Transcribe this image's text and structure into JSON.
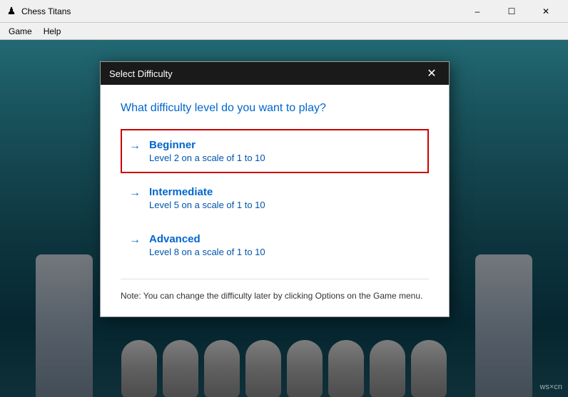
{
  "titlebar": {
    "icon": "♟",
    "title": "Chess Titans",
    "minimize_label": "–",
    "maximize_label": "☐",
    "close_label": "✕"
  },
  "menubar": {
    "items": [
      {
        "id": "game",
        "label": "Game"
      },
      {
        "id": "help",
        "label": "Help"
      }
    ]
  },
  "dialog": {
    "title": "Select Difficulty",
    "close_btn": "✕",
    "question": "What difficulty level do you want to play?",
    "options": [
      {
        "id": "beginner",
        "name": "Beginner",
        "desc": "Level 2 on a scale of 1 to 10",
        "selected": true
      },
      {
        "id": "intermediate",
        "name": "Intermediate",
        "desc": "Level 5 on a scale of 1 to 10",
        "selected": false
      },
      {
        "id": "advanced",
        "name": "Advanced",
        "desc": "Level 8 on a scale of 1 to 10",
        "selected": false
      }
    ],
    "note": "Note: You can change the difficulty later by clicking Options on the Game menu.",
    "arrow": "→"
  },
  "watermark": {
    "text": "ws×cn"
  },
  "colors": {
    "accent_blue": "#0066cc",
    "selected_border": "#cc0000",
    "dialog_bg": "#ffffff",
    "titlebar_bg": "#1a1a1a"
  }
}
